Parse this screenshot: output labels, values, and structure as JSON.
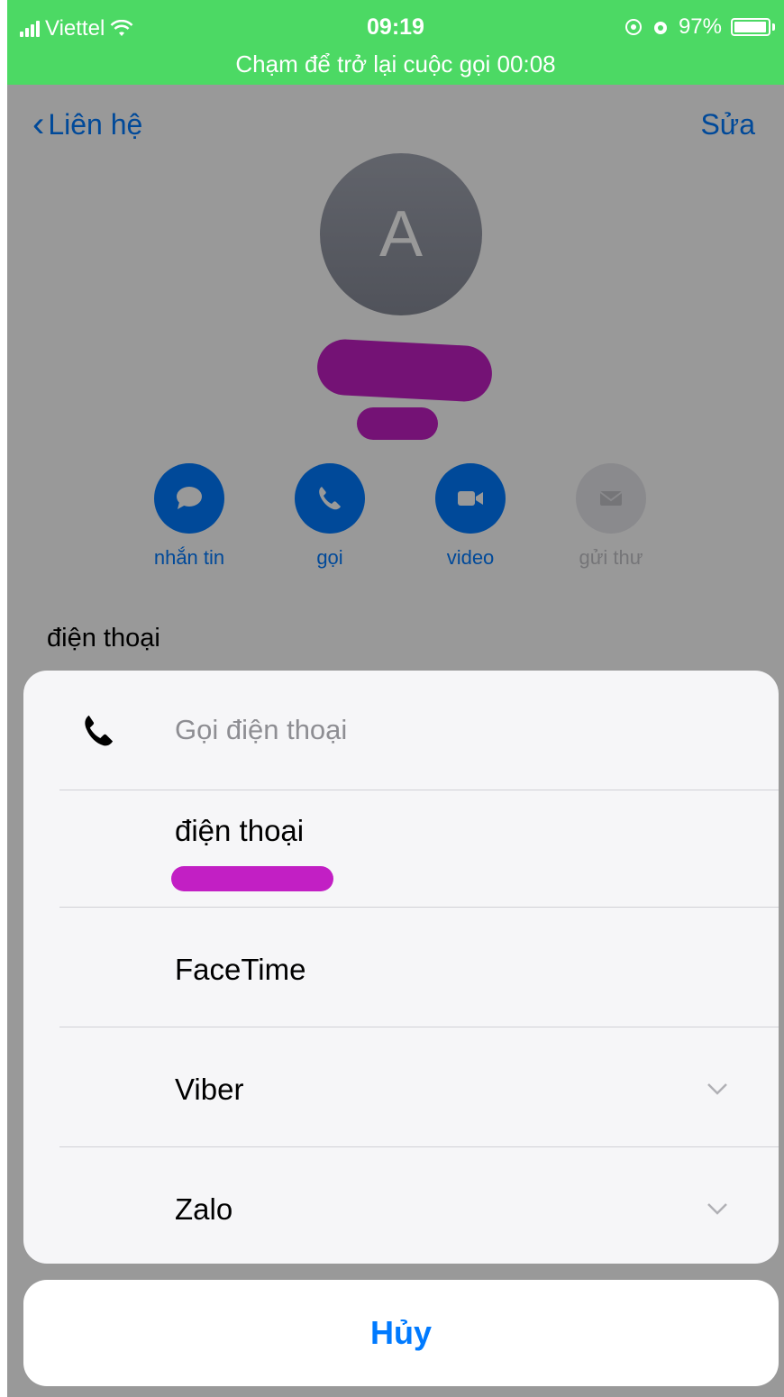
{
  "status_bar": {
    "carrier": "Viettel",
    "time": "09:19",
    "battery": "97%",
    "banner": "Chạm để trở lại cuộc gọi 00:08"
  },
  "nav": {
    "back_label": "Liên hệ",
    "edit_label": "Sửa"
  },
  "contact": {
    "avatar_initial": "A"
  },
  "actions": [
    {
      "label": "nhắn tin",
      "icon": "message-icon",
      "enabled": true
    },
    {
      "label": "gọi",
      "icon": "phone-icon",
      "enabled": true
    },
    {
      "label": "video",
      "icon": "video-icon",
      "enabled": true
    },
    {
      "label": "gửi thư",
      "icon": "mail-icon",
      "enabled": false
    }
  ],
  "section_label": "điện thoại",
  "sheet": {
    "title": "Gọi điện thoại",
    "header_icon": "phone-icon",
    "rows": [
      {
        "label": "điện thoại"
      },
      {
        "label": "FaceTime"
      },
      {
        "label": "Viber",
        "icon": "chevron-down-icon"
      },
      {
        "label": "Zalo",
        "icon": "chevron-down-icon"
      }
    ],
    "cancel_label": "Hủy"
  },
  "colors": {
    "accent": "#007aff",
    "call_banner": "#4cd964",
    "redaction": "#c21fc4"
  }
}
